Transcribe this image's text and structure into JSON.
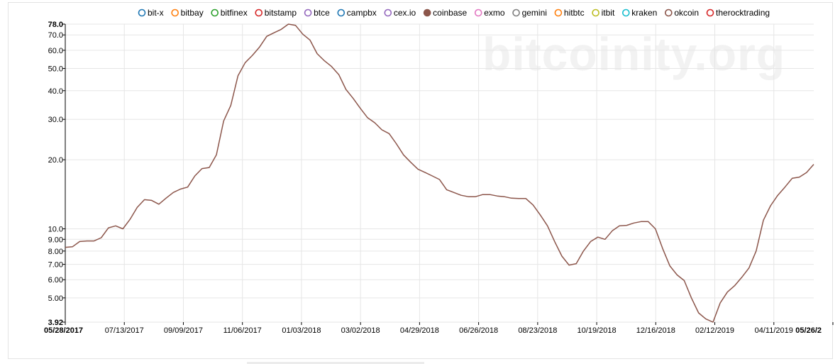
{
  "watermark": "bitcoinity.org",
  "chart_data": {
    "type": "line",
    "scale": "log",
    "ylim": [
      3.92,
      78.0
    ],
    "yticks": [
      "3.92",
      "5.00",
      "6.00",
      "7.00",
      "8.00",
      "9.00",
      "10.0",
      "20.0",
      "30.0",
      "40.0",
      "50.0",
      "60.0",
      "70.0",
      "78.0"
    ],
    "xticks": [
      "05/28/2017",
      "07/13/2017",
      "09/09/2017",
      "11/06/2017",
      "01/03/2018",
      "03/02/2018",
      "04/29/2018",
      "06/26/2018",
      "08/23/2018",
      "10/19/2018",
      "12/16/2018",
      "02/12/2019",
      "04/11/2019",
      "05/26/2"
    ],
    "grid": true,
    "legend_position": "top",
    "legend": [
      {
        "name": "bit-x",
        "color": "#1f77b4",
        "filled": false
      },
      {
        "name": "bitbay",
        "color": "#ff7f0e",
        "filled": false
      },
      {
        "name": "bitfinex",
        "color": "#2ca02c",
        "filled": false
      },
      {
        "name": "bitstamp",
        "color": "#d62728",
        "filled": false
      },
      {
        "name": "btce",
        "color": "#9467bd",
        "filled": false
      },
      {
        "name": "campbx",
        "color": "#1f77b4",
        "filled": false
      },
      {
        "name": "cex.io",
        "color": "#9467bd",
        "filled": false
      },
      {
        "name": "coinbase",
        "color": "#8c564b",
        "filled": true
      },
      {
        "name": "exmo",
        "color": "#e377c2",
        "filled": false
      },
      {
        "name": "gemini",
        "color": "#7f7f7f",
        "filled": false
      },
      {
        "name": "hitbtc",
        "color": "#ff7f0e",
        "filled": false
      },
      {
        "name": "itbit",
        "color": "#bcbd22",
        "filled": false
      },
      {
        "name": "kraken",
        "color": "#17becf",
        "filled": false
      },
      {
        "name": "okcoin",
        "color": "#8c564b",
        "filled": false
      },
      {
        "name": "therocktrading",
        "color": "#d62728",
        "filled": false
      }
    ],
    "series": [
      {
        "name": "coinbase",
        "color": "#8c564b",
        "values": [
          8.3,
          8.35,
          8.8,
          8.85,
          8.85,
          9.15,
          10.1,
          10.3,
          10.0,
          11.0,
          12.4,
          13.4,
          13.3,
          12.8,
          13.6,
          14.4,
          14.9,
          15.2,
          17.0,
          18.3,
          18.5,
          21.0,
          29.5,
          34.5,
          46.5,
          53.0,
          57.0,
          62.0,
          69.0,
          71.5,
          74.0,
          78.0,
          77.0,
          70.5,
          66.5,
          58.0,
          54.0,
          51.0,
          47.0,
          40.5,
          37.0,
          33.5,
          30.5,
          29.0,
          27.0,
          26.0,
          23.5,
          21.0,
          19.5,
          18.2,
          17.6,
          17.0,
          16.4,
          14.8,
          14.4,
          14.0,
          13.8,
          13.8,
          14.1,
          14.1,
          13.9,
          13.8,
          13.6,
          13.55,
          13.55,
          12.7,
          11.5,
          10.3,
          8.8,
          7.6,
          6.95,
          7.05,
          8.0,
          8.8,
          9.2,
          9.0,
          9.8,
          10.3,
          10.35,
          10.6,
          10.75,
          10.75,
          10.0,
          8.2,
          6.9,
          6.3,
          5.95,
          5.0,
          4.3,
          4.05,
          3.92,
          4.75,
          5.3,
          5.65,
          6.15,
          6.75,
          8.0,
          10.9,
          12.6,
          14.0,
          15.2,
          16.6,
          16.8,
          17.6,
          19.1
        ]
      }
    ]
  }
}
